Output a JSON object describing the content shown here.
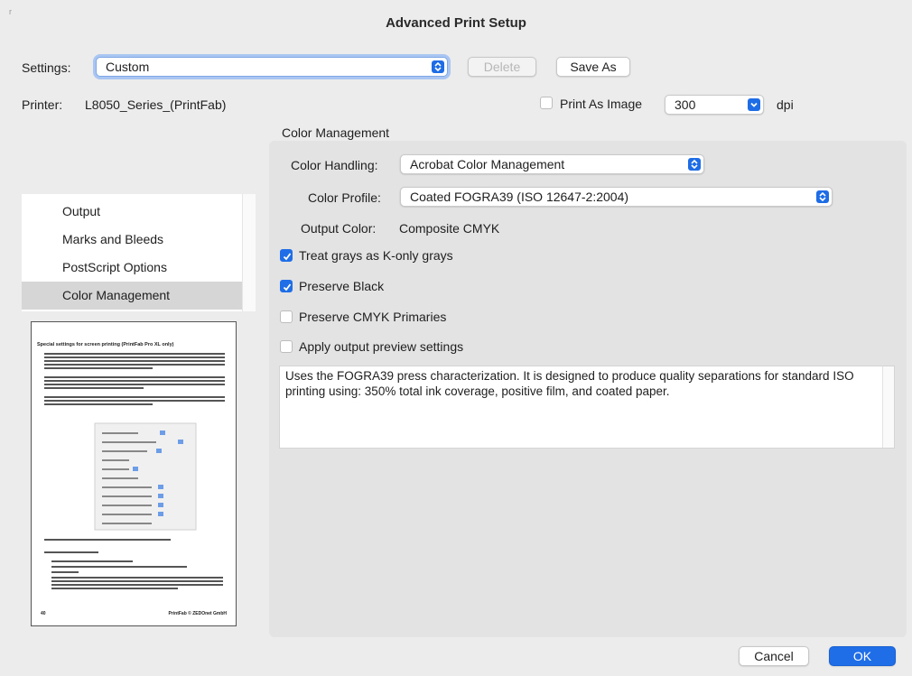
{
  "window": {
    "title": "Advanced Print Setup",
    "corner_mark": "r"
  },
  "settings": {
    "label": "Settings:",
    "value": "Custom",
    "delete_label": "Delete",
    "save_as_label": "Save As"
  },
  "printer": {
    "label": "Printer:",
    "value": "L8050_Series_(PrintFab)",
    "print_as_image_label": "Print As Image",
    "print_as_image_checked": false,
    "dpi_value": "300",
    "dpi_unit": "dpi"
  },
  "sidebar": {
    "items": [
      {
        "label": "Output",
        "selected": false
      },
      {
        "label": "Marks and Bleeds",
        "selected": false
      },
      {
        "label": "PostScript Options",
        "selected": false
      },
      {
        "label": "Color Management",
        "selected": true
      }
    ]
  },
  "preview": {
    "heading": "Special settings for screen printing (PrintFab Pro XL only)",
    "footer_left": "40",
    "footer_right": "PrintFab © ZEDOnet GmbH"
  },
  "color_management": {
    "section_title": "Color Management",
    "handling_label": "Color Handling:",
    "handling_value": "Acrobat Color Management",
    "profile_label": "Color Profile:",
    "profile_value": "Coated FOGRA39 (ISO 12647-2:2004)",
    "output_color_label": "Output Color:",
    "output_color_value": "Composite CMYK",
    "checkboxes": [
      {
        "label": "Treat grays as K-only grays",
        "checked": true
      },
      {
        "label": "Preserve Black",
        "checked": true
      },
      {
        "label": "Preserve CMYK Primaries",
        "checked": false
      },
      {
        "label": "Apply output preview settings",
        "checked": false
      }
    ],
    "description": "Uses the FOGRA39 press characterization. It is designed to produce quality separations for standard ISO printing using: 350% total ink coverage, positive film, and coated paper."
  },
  "footer": {
    "cancel_label": "Cancel",
    "ok_label": "OK"
  },
  "colors": {
    "accent": "#1f6ee8",
    "background": "#ececec",
    "panel": "#e3e3e3"
  }
}
